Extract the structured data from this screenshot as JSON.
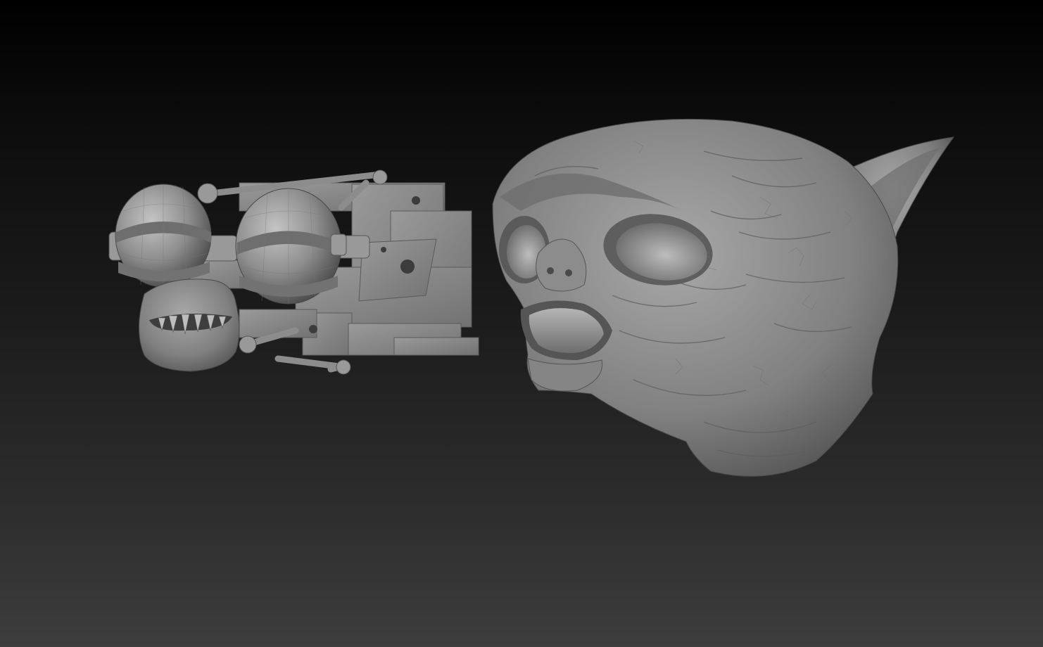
{
  "scene": {
    "background_colors": {
      "top": "#000000",
      "bottom": "#3d3d3d"
    },
    "material_color": "#8a8a8a",
    "subtools": [
      {
        "name": "animatronic-mechanism",
        "kind": "eye-mechanism with teeth"
      },
      {
        "name": "creature-head-sculpt",
        "kind": "alien creature head"
      }
    ]
  }
}
